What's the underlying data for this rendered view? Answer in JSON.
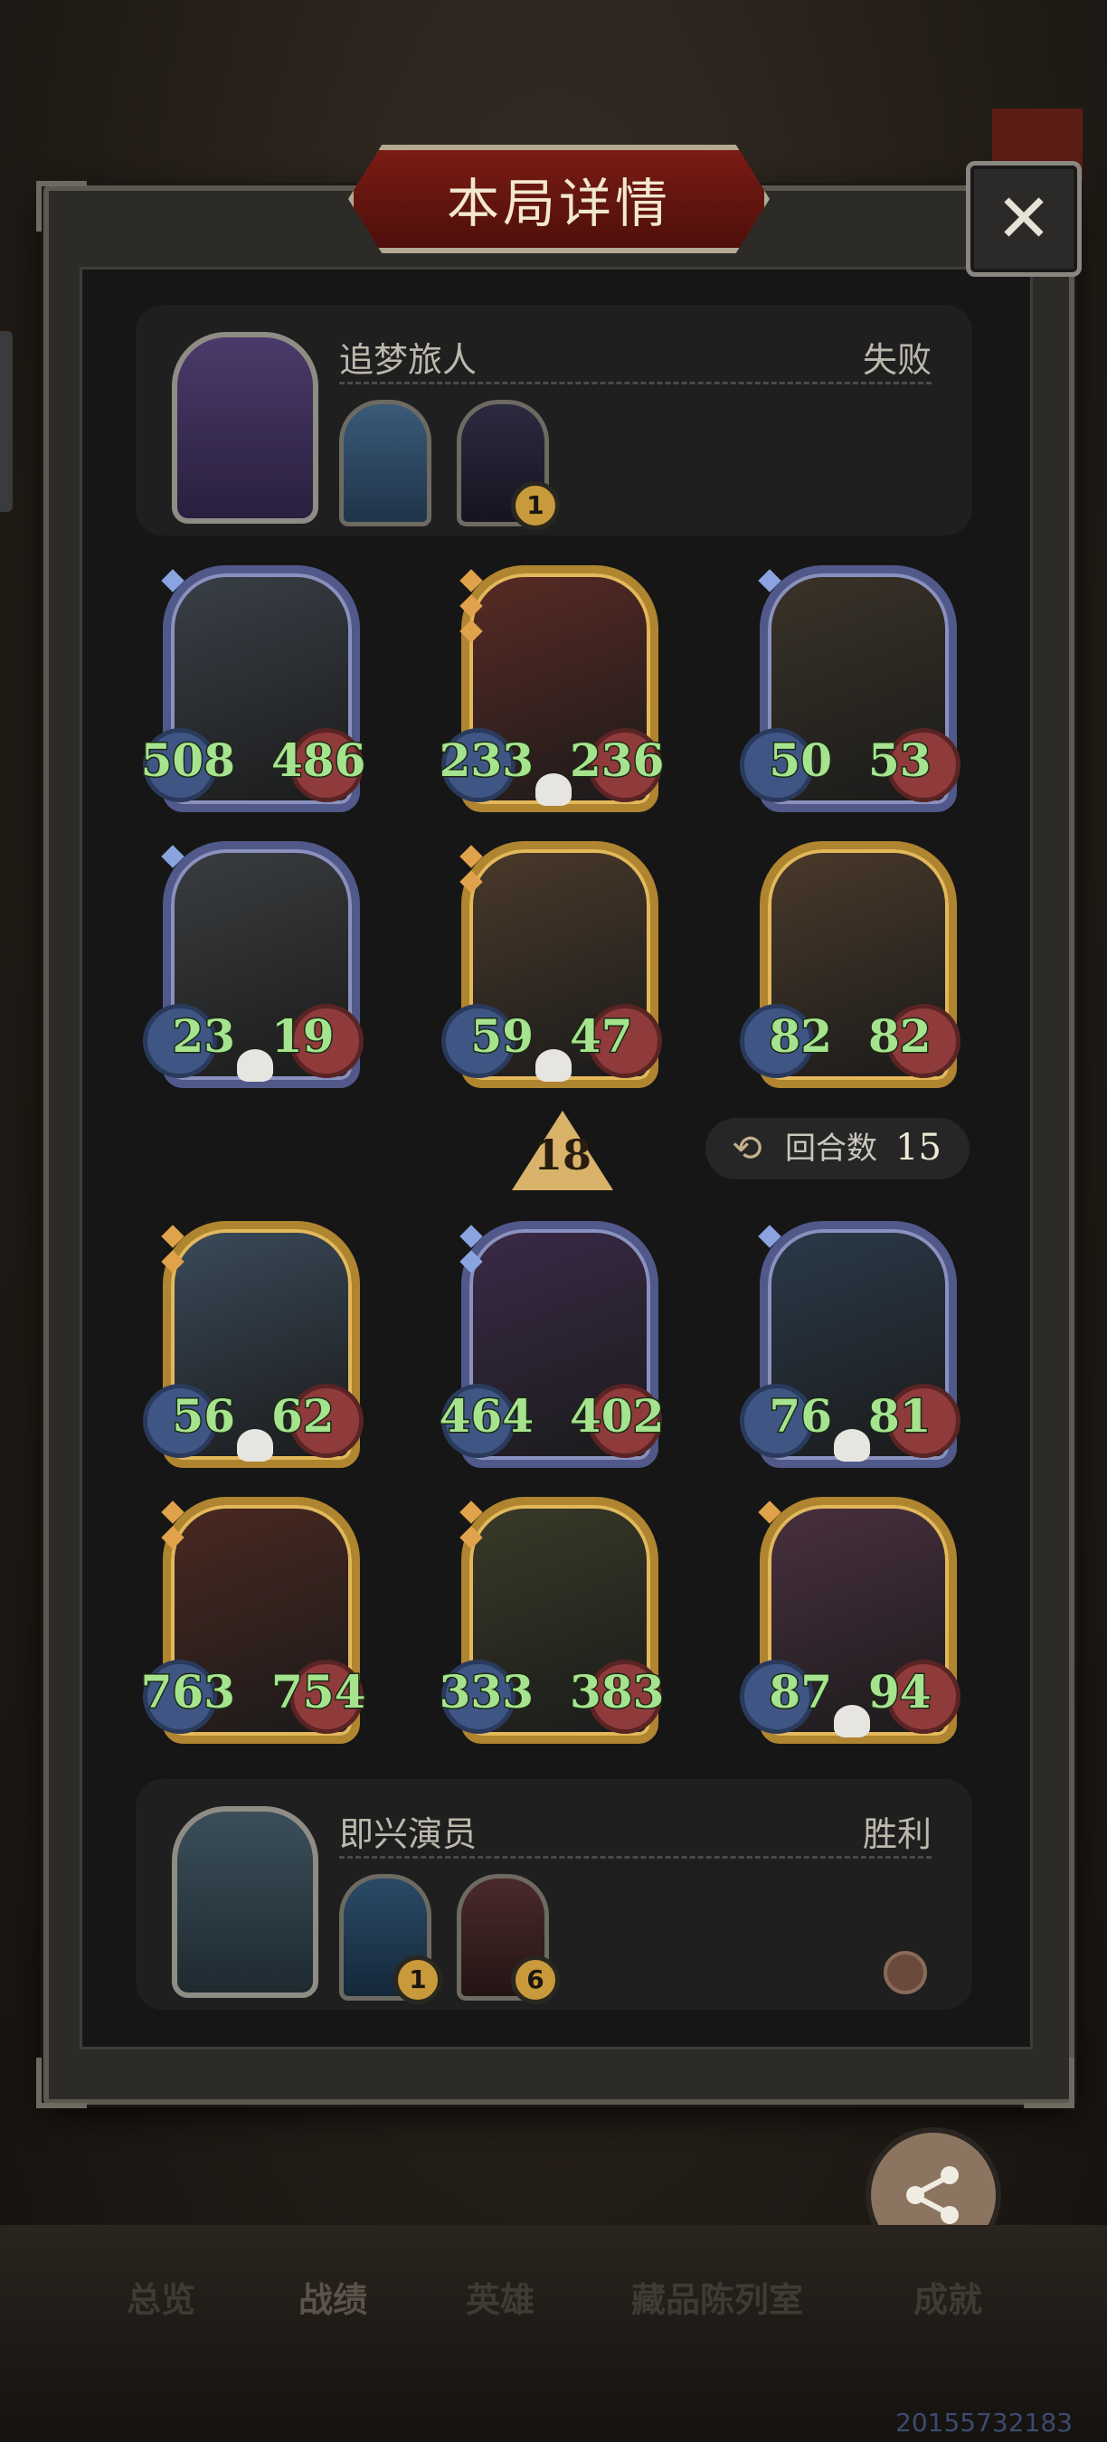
{
  "header": {
    "title": "本局详情",
    "close_label": "✕"
  },
  "player_top": {
    "name": "追梦旅人",
    "result": "失败",
    "items": [
      {
        "name": "item-1",
        "badge": ""
      },
      {
        "name": "item-2",
        "badge": "1"
      }
    ]
  },
  "player_bottom": {
    "name": "即兴演员",
    "result": "胜利",
    "items": [
      {
        "name": "item-1",
        "badge": "1"
      },
      {
        "name": "item-2",
        "badge": "6"
      }
    ]
  },
  "top_board": [
    {
      "attack": "508",
      "health": "486",
      "tier": "silver",
      "gems": 1,
      "skull": false
    },
    {
      "attack": "233",
      "health": "236",
      "tier": "gold",
      "gems": 3,
      "skull": true
    },
    {
      "attack": "50",
      "health": "53",
      "tier": "silver",
      "gems": 1,
      "skull": false
    },
    {
      "attack": "23",
      "health": "19",
      "tier": "silver",
      "gems": 1,
      "skull": true
    },
    {
      "attack": "59",
      "health": "47",
      "tier": "gold",
      "gems": 2,
      "skull": true
    },
    {
      "attack": "82",
      "health": "82",
      "tier": "gold",
      "gems": 0,
      "skull": false
    }
  ],
  "bottom_board": [
    {
      "attack": "56",
      "health": "62",
      "tier": "gold",
      "gems": 2,
      "skull": true
    },
    {
      "attack": "464",
      "health": "402",
      "tier": "silver",
      "gems": 2,
      "skull": false
    },
    {
      "attack": "76",
      "health": "81",
      "tier": "silver",
      "gems": 1,
      "skull": true
    },
    {
      "attack": "763",
      "health": "754",
      "tier": "gold",
      "gems": 2,
      "skull": false
    },
    {
      "attack": "333",
      "health": "383",
      "tier": "gold",
      "gems": 2,
      "skull": false
    },
    {
      "attack": "87",
      "health": "94",
      "tier": "gold",
      "gems": 1,
      "skull": true
    }
  ],
  "damage": "18",
  "turn_label": "回合数",
  "turn_count": "15",
  "share_label": "分享",
  "nav": [
    "总览",
    "战绩",
    "英雄",
    "藏品陈列室",
    "成就"
  ],
  "footer_id": "20155732183",
  "colors": {
    "gold": "#b08530",
    "silver": "#50598a",
    "stat_text": "#a6e38e",
    "panel": "#1f1f1f"
  }
}
